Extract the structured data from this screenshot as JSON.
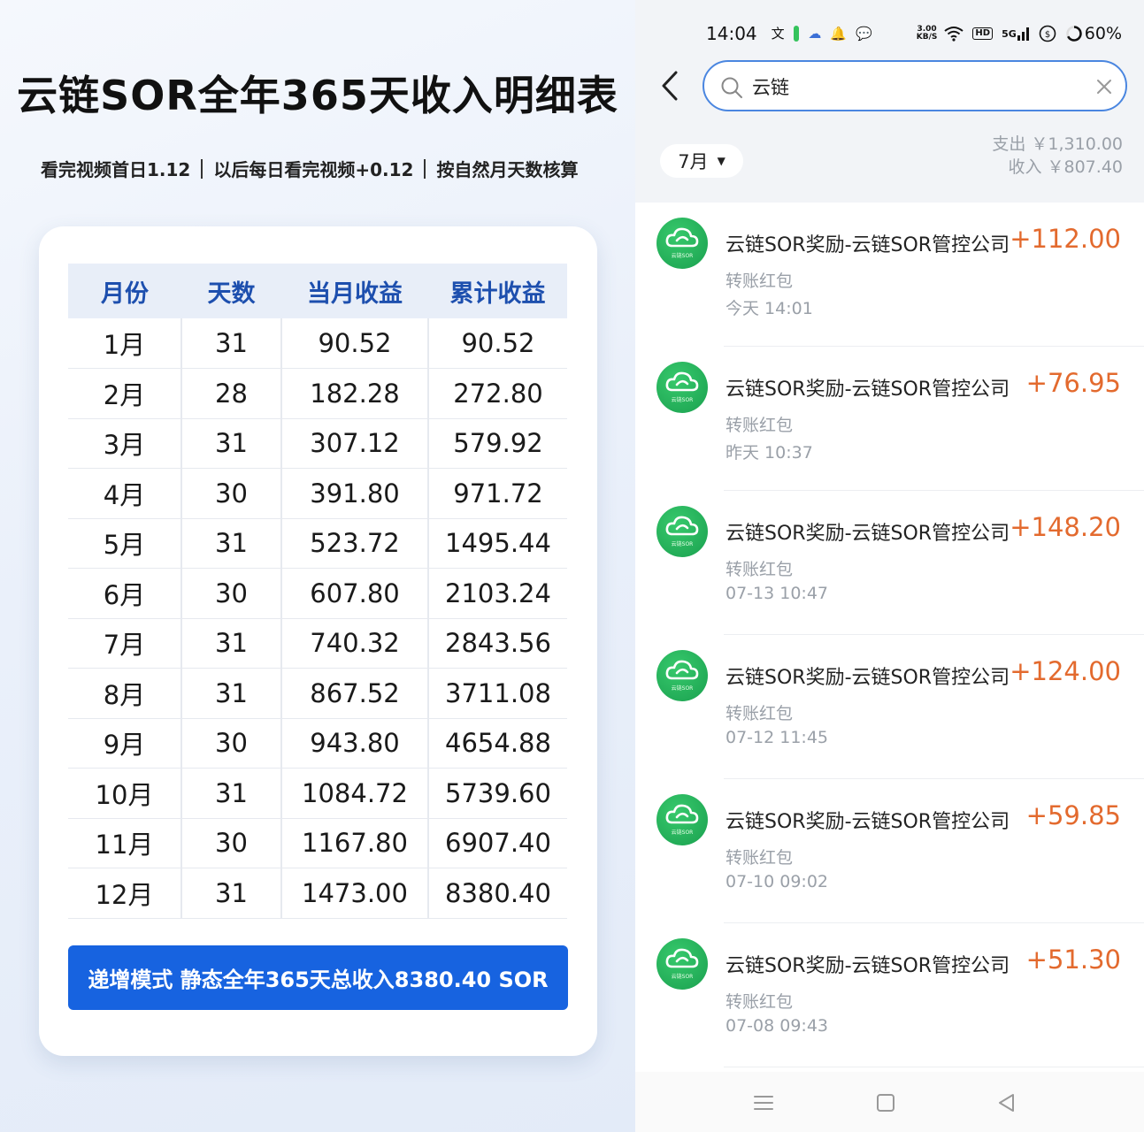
{
  "poster": {
    "title": "云链SOR全年365天收入明细表",
    "subtitle": [
      "看完视频首日1.12",
      "以后每日看完视频+0.12",
      "按自然月天数核算"
    ],
    "table": {
      "headers": [
        "月份",
        "天数",
        "当月收益",
        "累计收益"
      ],
      "rows": [
        [
          "1月",
          "31",
          "90.52",
          "90.52"
        ],
        [
          "2月",
          "28",
          "182.28",
          "272.80"
        ],
        [
          "3月",
          "31",
          "307.12",
          "579.92"
        ],
        [
          "4月",
          "30",
          "391.80",
          "971.72"
        ],
        [
          "5月",
          "31",
          "523.72",
          "1495.44"
        ],
        [
          "6月",
          "30",
          "607.80",
          "2103.24"
        ],
        [
          "7月",
          "31",
          "740.32",
          "2843.56"
        ],
        [
          "8月",
          "31",
          "867.52",
          "3711.08"
        ],
        [
          "9月",
          "30",
          "943.80",
          "4654.88"
        ],
        [
          "10月",
          "31",
          "1084.72",
          "5739.60"
        ],
        [
          "11月",
          "30",
          "1167.80",
          "6907.40"
        ],
        [
          "12月",
          "31",
          "1473.00",
          "8380.40"
        ]
      ]
    },
    "summary": "递增模式 静态全年365天总收入8380.40 SOR"
  },
  "phone": {
    "status": {
      "time": "14:04",
      "net_speed_top": "3.00",
      "net_speed_bottom": "KB/S",
      "hd": "HD",
      "signal": "5G",
      "battery": "60%"
    },
    "search": {
      "value": "云链"
    },
    "filter": {
      "month": "7月"
    },
    "totals": {
      "expense": "支出 ￥1,310.00",
      "income": "收入 ￥807.40"
    },
    "avatar_text": "云链SOR",
    "transactions": [
      {
        "title": "云链SOR奖励-云链SOR管控公司",
        "amount": "+112.00",
        "type": "转账红包",
        "time": "今天 14:01"
      },
      {
        "title": "云链SOR奖励-云链SOR管控公司",
        "amount": "+76.95",
        "type": "转账红包",
        "time": "昨天 10:37"
      },
      {
        "title": "云链SOR奖励-云链SOR管控公司",
        "amount": "+148.20",
        "type": "转账红包",
        "time": "07-13 10:47"
      },
      {
        "title": "云链SOR奖励-云链SOR管控公司",
        "amount": "+124.00",
        "type": "转账红包",
        "time": "07-12 11:45"
      },
      {
        "title": "云链SOR奖励-云链SOR管控公司",
        "amount": "+59.85",
        "type": "转账红包",
        "time": "07-10 09:02"
      },
      {
        "title": "云链SOR奖励-云链SOR管控公司",
        "amount": "+51.30",
        "type": "转账红包",
        "time": "07-08 09:43"
      }
    ],
    "colors": {
      "accent_blue": "#1763e0",
      "amount_orange": "#e36a2e",
      "avatar_green": "#1aa04f"
    }
  }
}
